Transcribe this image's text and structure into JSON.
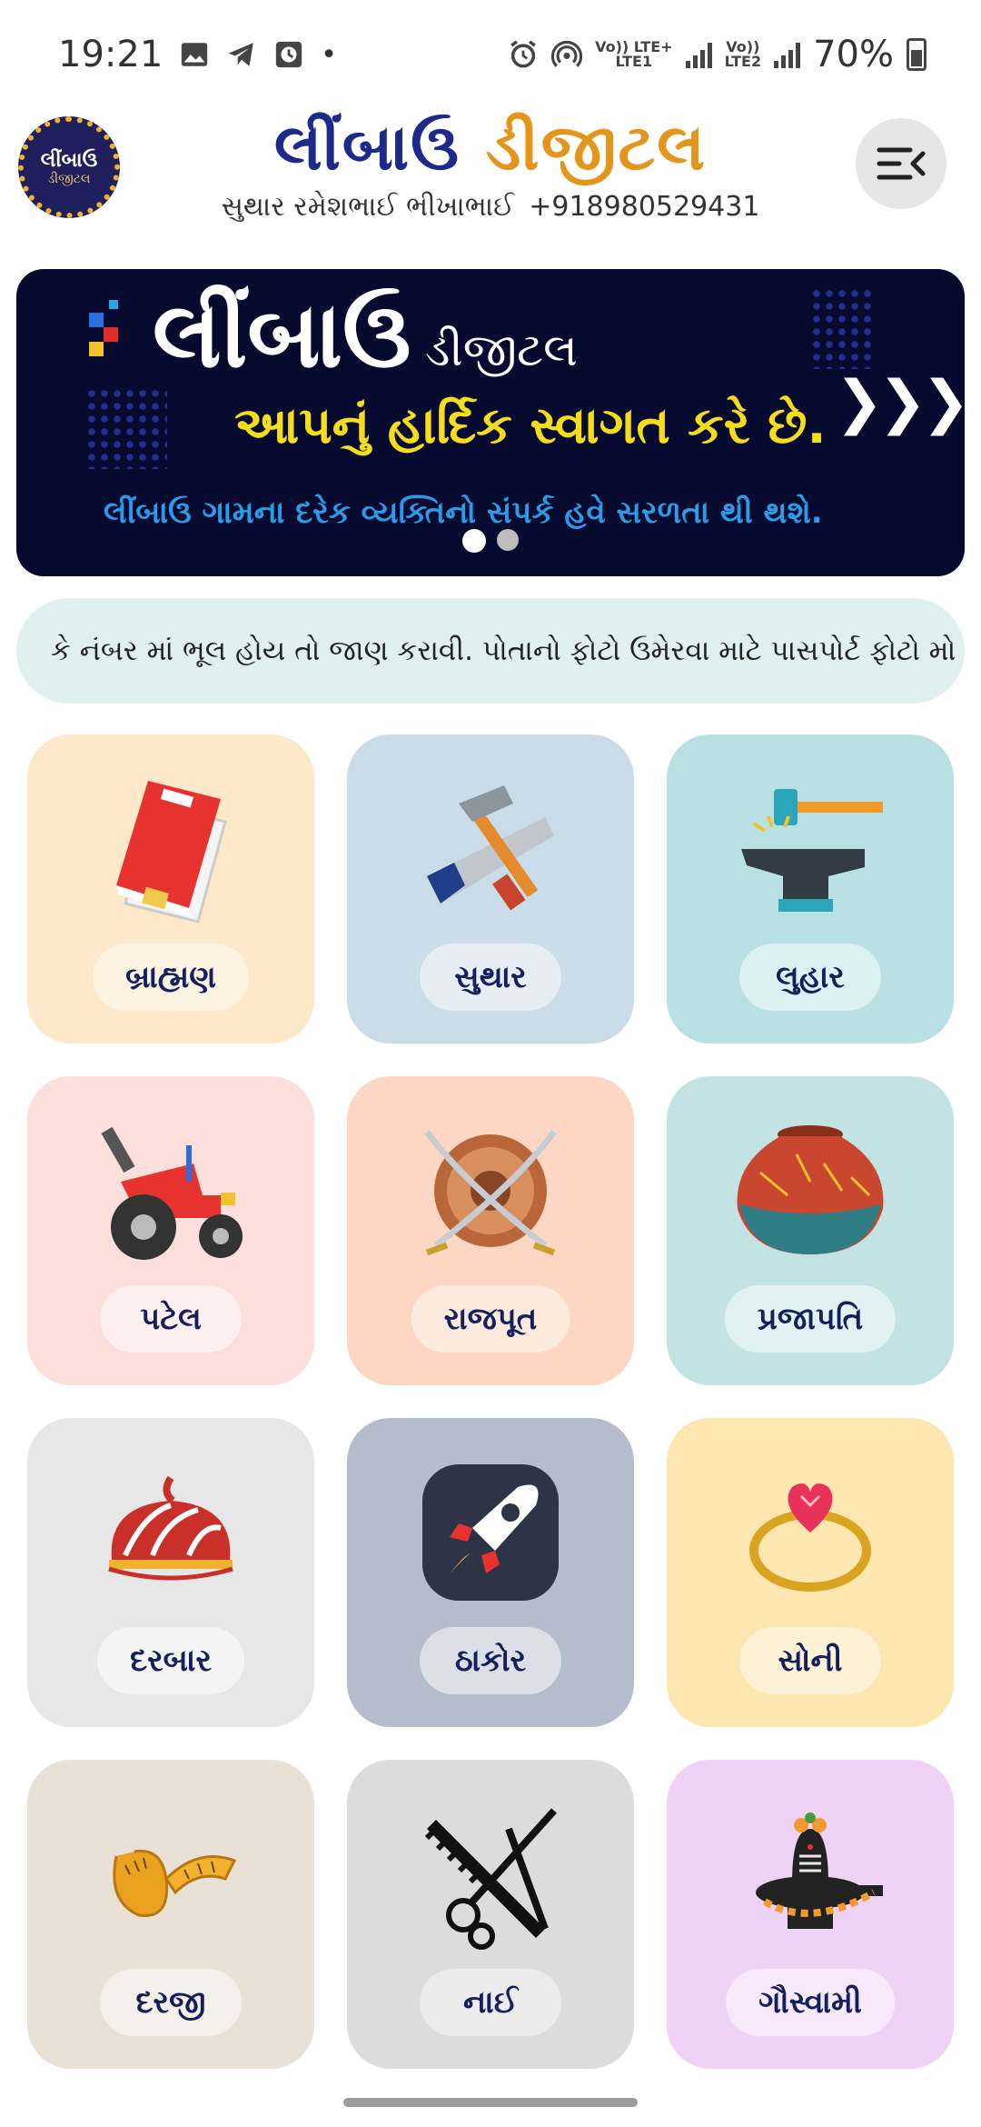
{
  "status_bar": {
    "time": "19:21",
    "notification_dot": "•",
    "net1": "Vo)) LTE+",
    "net1_sub": "LTE1",
    "net2": "Vo))",
    "net2_sub": "LTE2",
    "battery": "70%"
  },
  "header": {
    "logo_line1": "લીંબાઉ",
    "logo_line2": "ડીજીટલ",
    "brand_part1": "લીંબાઉ",
    "brand_part2": "ડીજીટલ",
    "owner_name": "સુથાર રમેશભાઈ ભીખાભાઈ",
    "owner_phone": "+918980529431",
    "colors": {
      "brand_blue": "#1d2a8a",
      "brand_orange": "#e4951b"
    }
  },
  "banner": {
    "title": "લીંબાઉ",
    "subtitle": "ડીજીટલ",
    "welcome": "આપનું હાર્દિક સ્વાગત કરે છે.",
    "info": "લીંબાઉ ગામના દરેક વ્યક્તિનો સંપર્ક હવે સરળતા થી થશે.",
    "chevrons": "❯❯❯",
    "active_slide": 1,
    "slide_count": 2
  },
  "marquee": {
    "text": "કે નંબર માં ભૂલ હોય તો જાણ કરાવી. પોતાનો ફોટો ઉમેરવા માટે પાસપોર્ટ ફોટો મો"
  },
  "categories": [
    {
      "label": "બ્રાહ્મણ",
      "icon": "book-icon",
      "bg": "#fde9c9",
      "pill": "#fdf3e1"
    },
    {
      "label": "સુથાર",
      "icon": "carpenter-tools-icon",
      "bg": "#c9dce8",
      "pill": "#e6eef4"
    },
    {
      "label": "લુહાર",
      "icon": "anvil-hammer-icon",
      "bg": "#b9e0e2",
      "pill": "#ddf1f2"
    },
    {
      "label": "પટેલ",
      "icon": "tractor-icon",
      "bg": "#fde0dc",
      "pill": "#fdf0ee"
    },
    {
      "label": "રાજપૂત",
      "icon": "shield-swords-icon",
      "bg": "#fdd7c3",
      "pill": "#fdeadf"
    },
    {
      "label": "પ્રજાપતિ",
      "icon": "clay-pot-icon",
      "bg": "#c3e2e4",
      "pill": "#e2f1f2"
    },
    {
      "label": "દરબાર",
      "icon": "turban-icon",
      "bg": "#e7e7e7",
      "pill": "#f4f4f4"
    },
    {
      "label": "ઠાકોર",
      "icon": "rocket-icon",
      "bg": "#b5bccb",
      "pill": "#dcdfe6"
    },
    {
      "label": "સોની",
      "icon": "gold-ring-icon",
      "bg": "#fde6b0",
      "pill": "#fdf2d6"
    },
    {
      "label": "દરજી",
      "icon": "measuring-tape-icon",
      "bg": "#e9e1d6",
      "pill": "#f4efe9"
    },
    {
      "label": "નાઈ",
      "icon": "comb-scissors-icon",
      "bg": "#dcdcdc",
      "pill": "#ececec"
    },
    {
      "label": "ગૌસ્વામી",
      "icon": "shivling-icon",
      "bg": "#efd3f7",
      "pill": "#f7e8fb"
    }
  ]
}
